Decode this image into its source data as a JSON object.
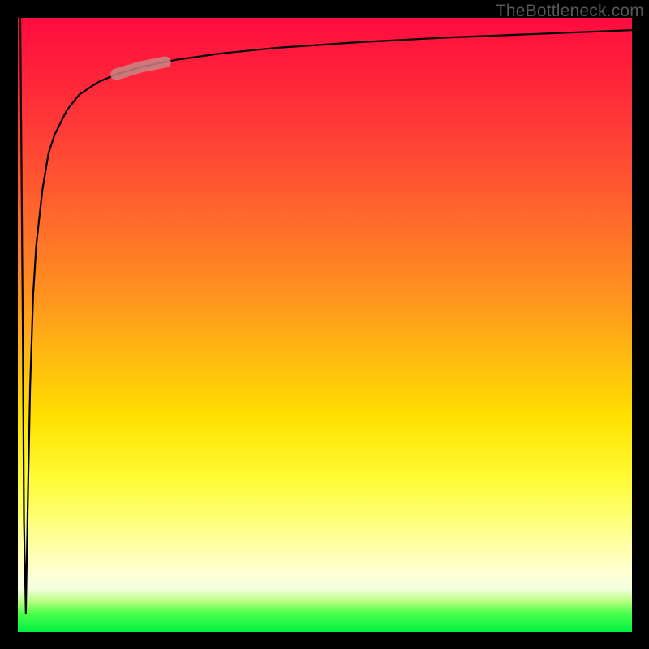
{
  "credit": "TheBottleneck.com",
  "chart_data": {
    "type": "line",
    "title": "",
    "xlabel": "",
    "ylabel": "",
    "xlim": [
      0,
      100
    ],
    "ylim": [
      0,
      100
    ],
    "grid": false,
    "legend": false,
    "series": [
      {
        "name": "bottleneck-curve",
        "x": [
          0.4,
          0.8,
          1.0,
          1.3,
          1.6,
          2.0,
          2.5,
          3.0,
          4.0,
          5.0,
          6.0,
          8.0,
          10,
          13,
          16,
          20,
          26,
          33,
          42,
          55,
          70,
          85,
          100
        ],
        "y": [
          100,
          50,
          18,
          3,
          20,
          40,
          55,
          63,
          72,
          78,
          81,
          85,
          87.5,
          89.5,
          90.8,
          92,
          93.2,
          94.2,
          95.1,
          96,
          96.8,
          97.4,
          98
        ]
      }
    ],
    "annotations": [
      {
        "name": "highlight-segment",
        "x_range": [
          16,
          24
        ],
        "color": "#c88a86",
        "note": "rounded highlight overlay on curve"
      }
    ],
    "background_gradient": {
      "direction": "top-to-bottom",
      "stops": [
        {
          "pos": 0.0,
          "color": "#ff0b3f"
        },
        {
          "pos": 0.2,
          "color": "#ff4136"
        },
        {
          "pos": 0.45,
          "color": "#ff9220"
        },
        {
          "pos": 0.65,
          "color": "#ffe000"
        },
        {
          "pos": 0.82,
          "color": "#feff7a"
        },
        {
          "pos": 0.93,
          "color": "#f5ffe0"
        },
        {
          "pos": 1.0,
          "color": "#00f040"
        }
      ]
    }
  }
}
